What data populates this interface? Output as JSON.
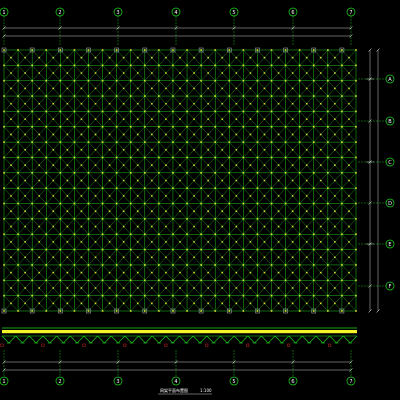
{
  "drawing": {
    "background_color": "#000000",
    "grid_color": "#22dd22",
    "node_color": "#dddd33",
    "support_color": "#9aa0a6",
    "dimension_color": "#ffffff",
    "axis_color": "#22dd22",
    "elevation_band_color": "#f4f42a",
    "annotation_color": "#ff3333"
  },
  "axes": {
    "columns": [
      "1",
      "2",
      "3",
      "4",
      "5",
      "6",
      "7"
    ],
    "rows": [
      "A",
      "B",
      "C",
      "D",
      "E",
      "F"
    ]
  },
  "plan": {
    "caption": "网架平面布置图",
    "scale": "1:100",
    "top_total_label": "",
    "bottom_total_label": ""
  },
  "grid_modules": {
    "columns": 25,
    "rows": 17
  }
}
